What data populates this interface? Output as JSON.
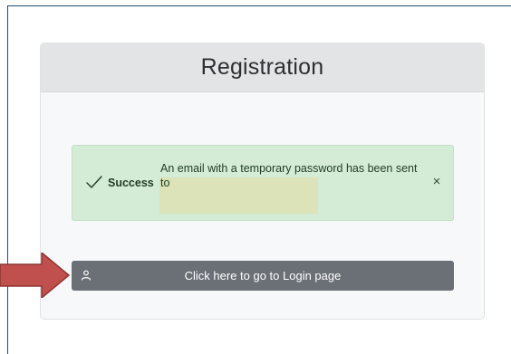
{
  "card": {
    "title": "Registration"
  },
  "alert": {
    "status_label": "Success",
    "message": "An email with a temporary password has been sent to",
    "icon": "check-icon",
    "close_icon": "close-icon",
    "close_glyph": "×",
    "color": "#d4ecd5"
  },
  "login_button": {
    "label": "Click here to go to Login page",
    "icon": "user-icon",
    "color": "#6b7076"
  },
  "annotation": {
    "icon": "arrow-right-icon",
    "color": "#c0504d"
  }
}
